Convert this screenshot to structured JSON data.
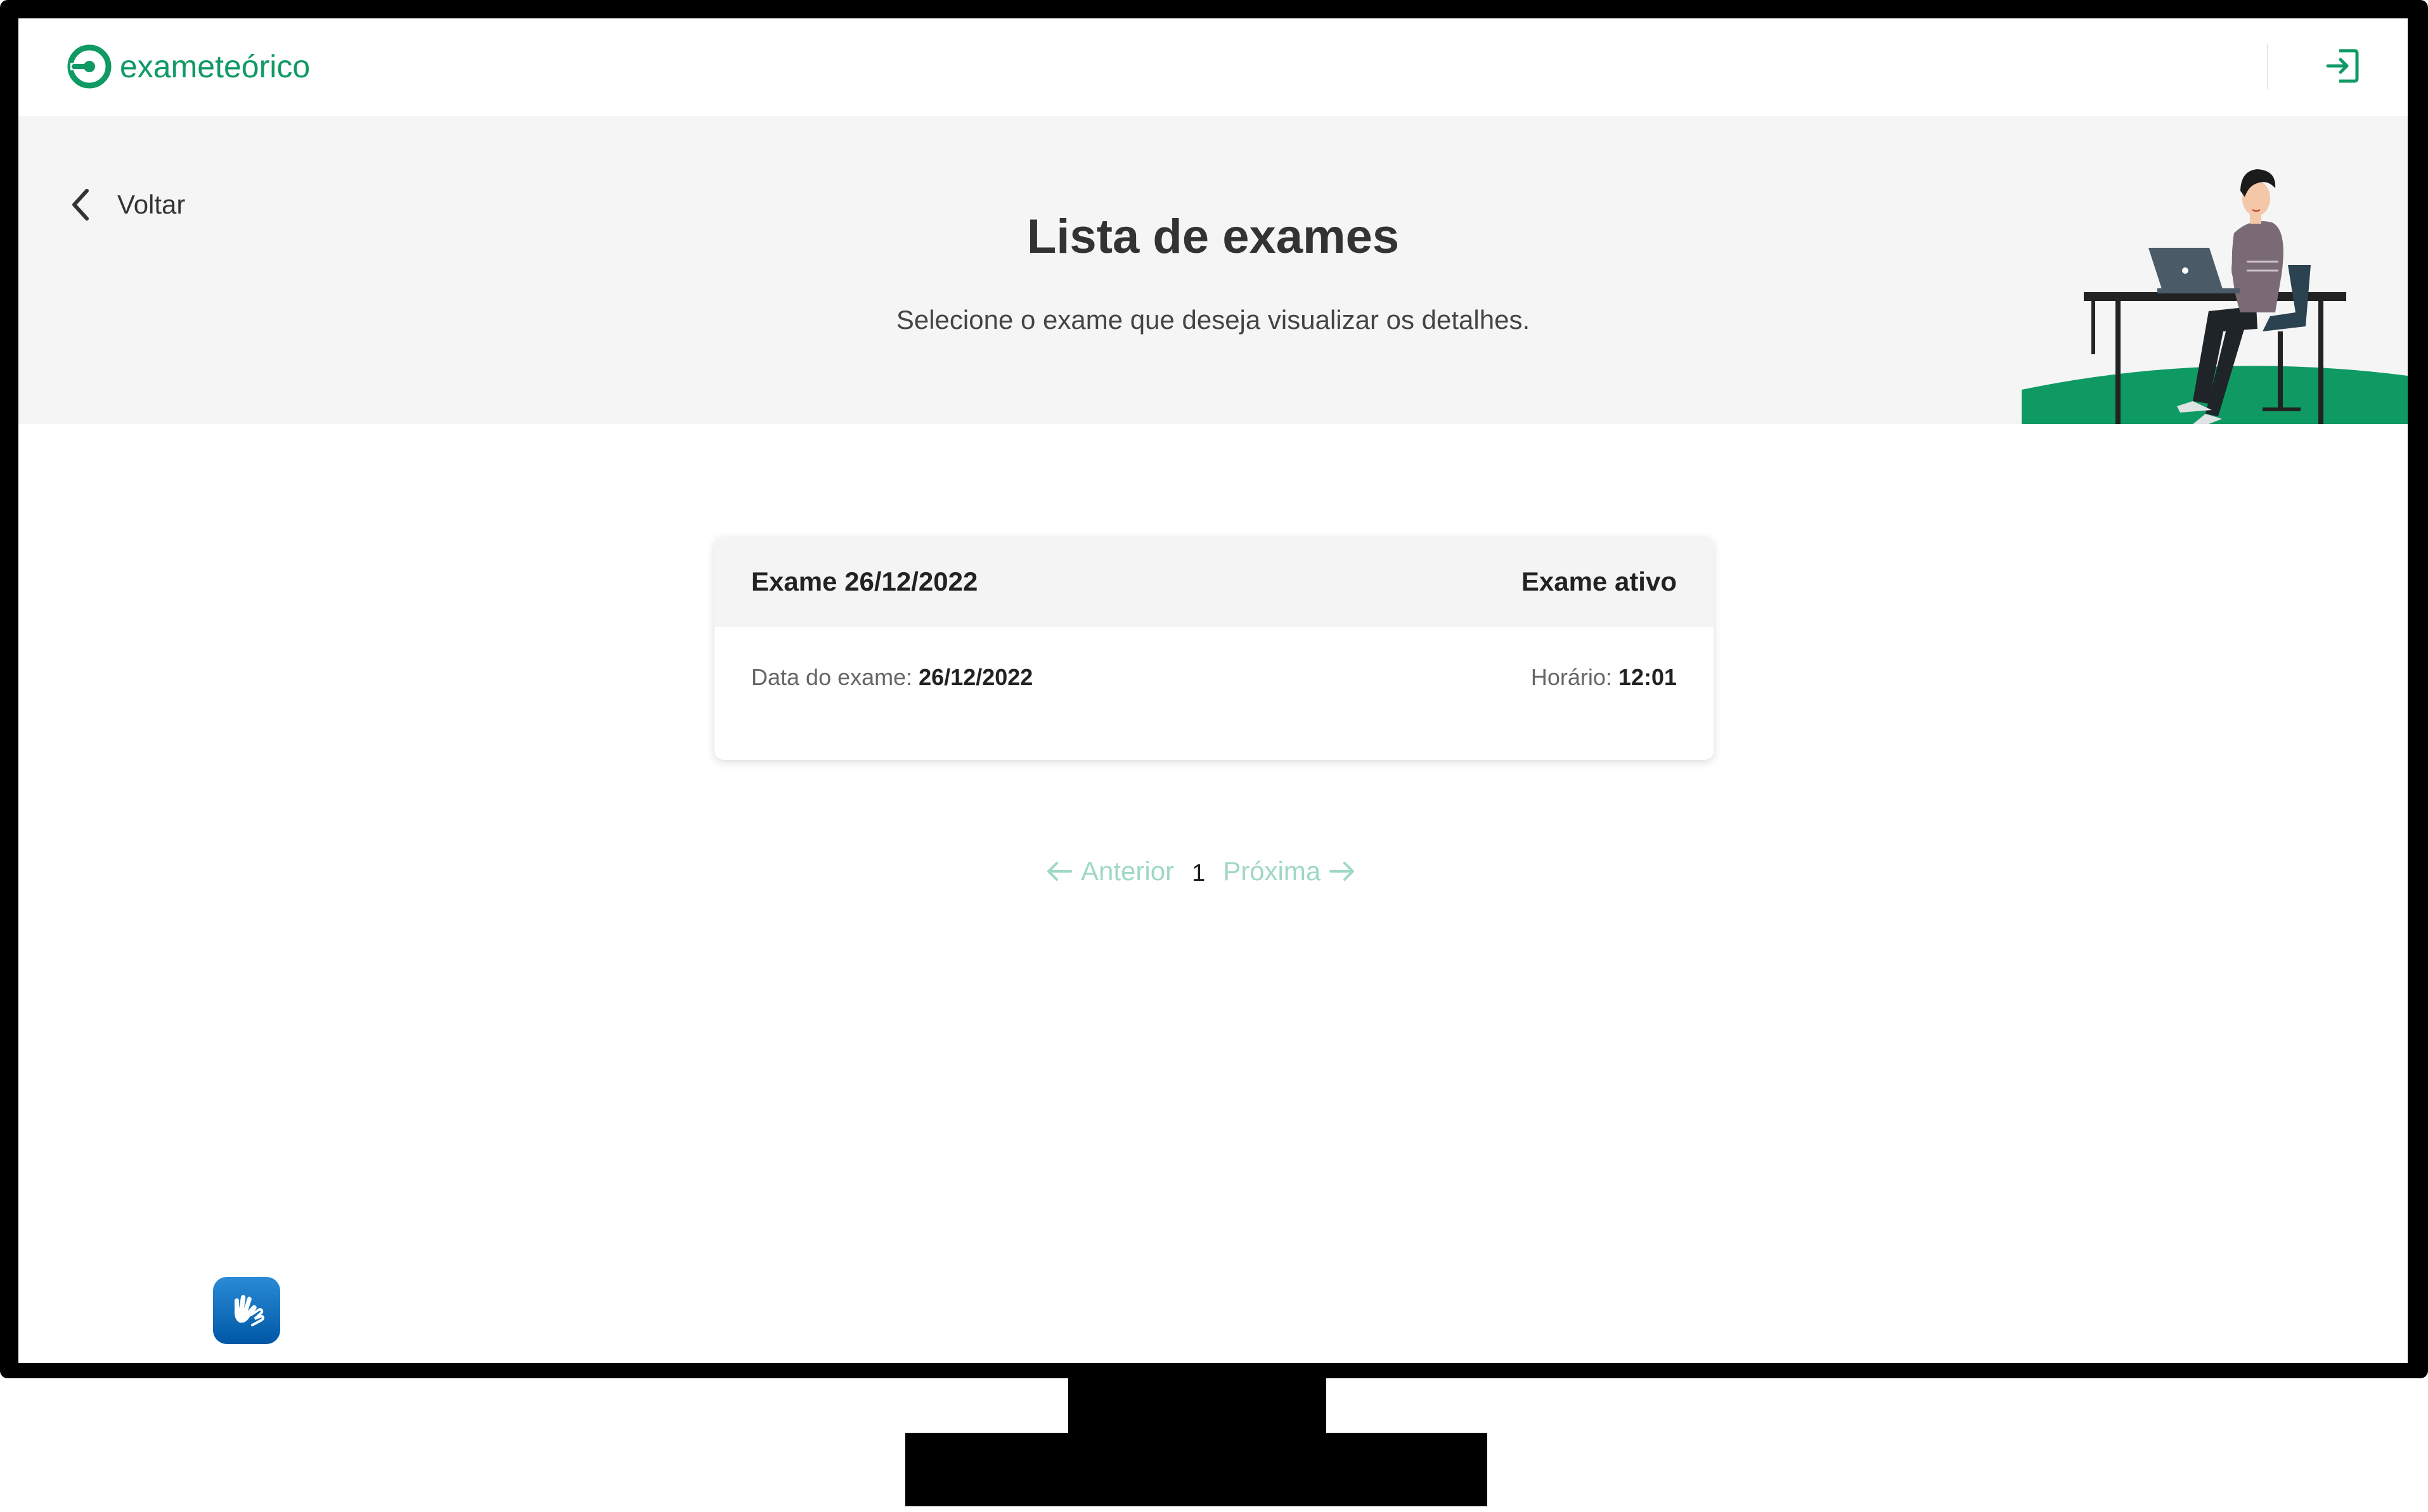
{
  "header": {
    "brand": "exameteórico",
    "logo_icon": "brand-logo-icon",
    "logout_icon": "logout-icon",
    "brand_color": "#0f9a64"
  },
  "hero": {
    "back_label": "Voltar",
    "title": "Lista de exames",
    "subtitle": "Selecione o exame que deseja visualizar os detalhes.",
    "illustration": "person-at-laptop-illustration"
  },
  "exams": [
    {
      "title": "Exame 26/12/2022",
      "status": "Exame ativo",
      "date_label": "Data do exame: ",
      "date_value": "26/12/2022",
      "time_label": "Horário: ",
      "time_value": "12:01"
    }
  ],
  "pagination": {
    "prev_label": "Anterior",
    "current_page": "1",
    "next_label": "Próxima"
  },
  "accessibility": {
    "icon": "sign-language-icon",
    "color": "#0a6cc2"
  }
}
